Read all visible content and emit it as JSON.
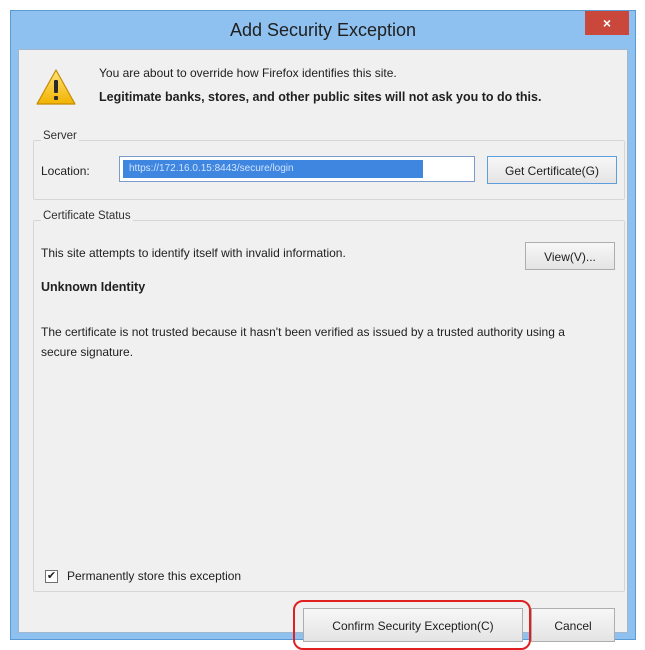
{
  "window": {
    "title": "Add Security Exception",
    "close_label": "×"
  },
  "warning": {
    "icon": "warning-triangle-icon",
    "line1": "You are about to override how Firefox identifies this site.",
    "line2": "Legitimate banks, stores, and other public sites will not ask you to do this."
  },
  "server": {
    "group_label": "Server",
    "location_label": "Location:",
    "location_value": "https://172.16.0.15:8443/secure/login",
    "get_certificate_label": "Get Certificate(G)"
  },
  "certificate_status": {
    "group_label": "Certificate Status",
    "status_text": "This site attempts to identify itself with invalid information.",
    "view_label": "View(V)...",
    "identity_title": "Unknown Identity",
    "identity_description": "The certificate is not trusted because it hasn't been verified as issued by a trusted authority using a secure signature."
  },
  "options": {
    "permanent_checkbox_label": "Permanently store this exception",
    "permanent_checked": true
  },
  "buttons": {
    "confirm_label": "Confirm Security Exception(C)",
    "cancel_label": "Cancel"
  },
  "colors": {
    "title_bar": "#8ec1ef",
    "close_button": "#c9483b",
    "highlight": "#e02020",
    "selection": "#3f86e0"
  }
}
